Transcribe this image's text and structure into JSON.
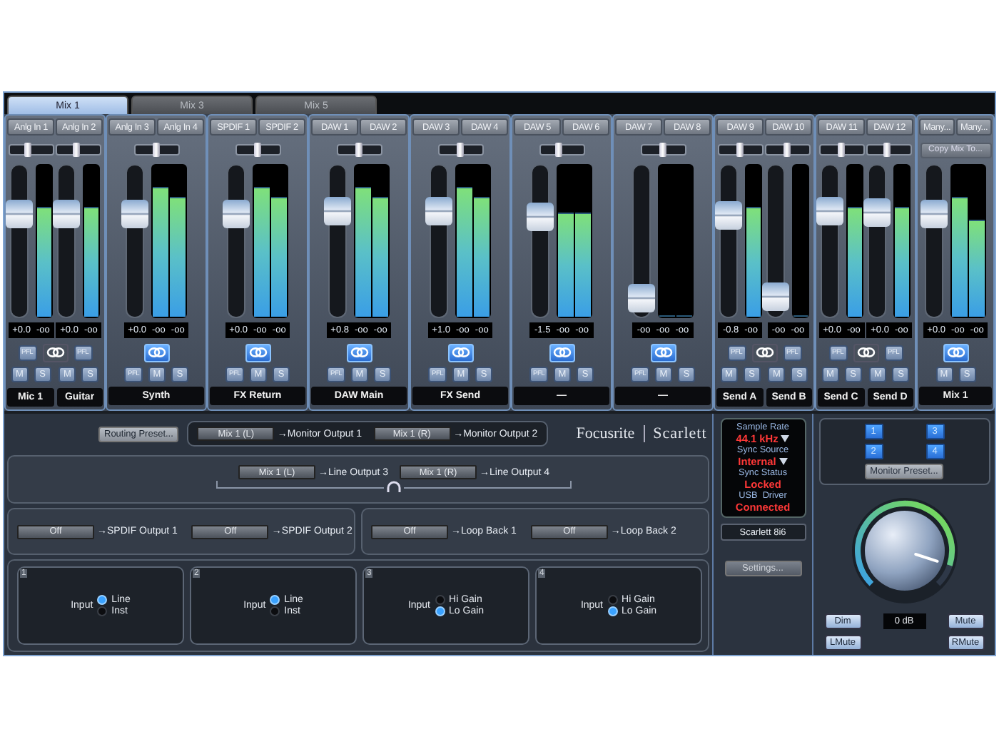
{
  "tabs": [
    {
      "label": "Mix 1",
      "selected": true
    },
    {
      "label": "Mix 3",
      "selected": false
    },
    {
      "label": "Mix 5",
      "selected": false
    }
  ],
  "groups": [
    {
      "kind": "mono",
      "linked": false,
      "channels": [
        {
          "source": "Anlg In 1",
          "pan": {
            "level": 0.42
          },
          "fader": {
            "level": 0.72
          },
          "meters": [
            {
              "level": 0.72
            }
          ],
          "readings": [
            "+0.0",
            "-oo"
          ],
          "pfl": "PFL",
          "buttons": [
            "M",
            "S"
          ],
          "name": "Mic 1"
        },
        {
          "source": "Anlg In 2",
          "pan": {
            "level": 0.45
          },
          "fader": {
            "level": 0.72
          },
          "meters": [
            {
              "level": 0.72
            }
          ],
          "readings": [
            "+0.0",
            "-oo"
          ],
          "pfl": "PFL",
          "buttons": [
            "M",
            "S"
          ],
          "name": "Guitar"
        }
      ]
    },
    {
      "kind": "stereo",
      "sources": [
        "Anlg In 3",
        "Anlg In 4"
      ],
      "pan": {
        "level": 0.5
      },
      "fader": {
        "level": 0.72
      },
      "meters": [
        {
          "level": 0.85
        },
        {
          "level": 0.78
        }
      ],
      "readings": [
        "+0.0",
        "-oo",
        "-oo"
      ],
      "linked": true,
      "pfl": "PFL",
      "buttons": [
        "M",
        "S"
      ],
      "name": "Synth"
    },
    {
      "kind": "stereo",
      "sources": [
        "SPDIF 1",
        "SPDIF 2"
      ],
      "pan": {
        "level": 0.5
      },
      "fader": {
        "level": 0.72
      },
      "meters": [
        {
          "level": 0.85
        },
        {
          "level": 0.78
        }
      ],
      "readings": [
        "+0.0",
        "-oo",
        "-oo"
      ],
      "linked": true,
      "pfl": "PFL",
      "buttons": [
        "M",
        "S"
      ],
      "name": "FX Return"
    },
    {
      "kind": "stereo",
      "sources": [
        "DAW 1",
        "DAW 2"
      ],
      "pan": {
        "level": 0.5
      },
      "fader": {
        "level": 0.75
      },
      "meters": [
        {
          "level": 0.85
        },
        {
          "level": 0.78
        }
      ],
      "readings": [
        "+0.8",
        "-oo",
        "-oo"
      ],
      "linked": true,
      "pfl": "PFL",
      "buttons": [
        "M",
        "S"
      ],
      "name": "DAW Main"
    },
    {
      "kind": "stereo",
      "sources": [
        "DAW 3",
        "DAW 4"
      ],
      "pan": {
        "level": 0.5
      },
      "fader": {
        "level": 0.74
      },
      "meters": [
        {
          "level": 0.85
        },
        {
          "level": 0.78
        }
      ],
      "readings": [
        "+1.0",
        "-oo",
        "-oo"
      ],
      "linked": true,
      "pfl": "PFL",
      "buttons": [
        "M",
        "S"
      ],
      "name": "FX Send"
    },
    {
      "kind": "stereo",
      "sources": [
        "DAW 5",
        "DAW 6"
      ],
      "pan": {
        "level": 0.45
      },
      "fader": {
        "level": 0.7
      },
      "meters": [
        {
          "level": 0.68
        },
        {
          "level": 0.68
        }
      ],
      "readings": [
        "-1.5",
        "-oo",
        "-oo"
      ],
      "linked": true,
      "pfl": "PFL",
      "buttons": [
        "M",
        "S"
      ],
      "name": "—"
    },
    {
      "kind": "stereo",
      "sources": [
        "DAW 7",
        "DAW 8"
      ],
      "pan": {
        "level": 0.5
      },
      "fader": {
        "level": 0.04
      },
      "meters": [
        {
          "level": 0
        },
        {
          "level": 0
        }
      ],
      "readings": [
        "-oo",
        "-oo",
        "-oo"
      ],
      "linked": true,
      "pfl": "PFL",
      "buttons": [
        "M",
        "S"
      ],
      "name": "—"
    },
    {
      "kind": "mono",
      "linked": false,
      "channels": [
        {
          "source": "DAW 9",
          "pan": {
            "level": 0.5
          },
          "fader": {
            "level": 0.71
          },
          "meters": [
            {
              "level": 0.72
            }
          ],
          "readings": [
            "-0.8",
            "-oo"
          ],
          "pfl": "PFL",
          "buttons": [
            "M",
            "S"
          ],
          "name": "Send A"
        },
        {
          "source": "DAW 10",
          "pan": {
            "level": 0.5
          },
          "fader": {
            "level": 0.05
          },
          "meters": [
            {
              "level": 0
            }
          ],
          "readings": [
            "-oo",
            "-oo"
          ],
          "pfl": "PFL",
          "buttons": [
            "M",
            "S"
          ],
          "name": "Send B"
        }
      ]
    },
    {
      "kind": "mono",
      "linked": false,
      "channels": [
        {
          "source": "DAW 11",
          "pan": {
            "level": 0.5
          },
          "fader": {
            "level": 0.74
          },
          "meters": [
            {
              "level": 0.72
            }
          ],
          "readings": [
            "+0.0",
            "-oo"
          ],
          "pfl": "PFL",
          "buttons": [
            "M",
            "S"
          ],
          "name": "Send C"
        },
        {
          "source": "DAW 12",
          "pan": {
            "level": 0.45
          },
          "fader": {
            "level": 0.73
          },
          "meters": [
            {
              "level": 0.72
            }
          ],
          "readings": [
            "+0.0",
            "-oo"
          ],
          "pfl": "PFL",
          "buttons": [
            "M",
            "S"
          ],
          "name": "Send D"
        }
      ]
    },
    {
      "kind": "master",
      "sources": [
        "Many...",
        "Many..."
      ],
      "copy": "Copy Mix To...",
      "fader": {
        "level": 0.72
      },
      "meters": [
        {
          "level": 0.78
        },
        {
          "level": 0.63
        }
      ],
      "readings": [
        "+0.0",
        "-oo",
        "-oo"
      ],
      "linked": true,
      "buttons": [
        "M",
        "S"
      ],
      "name": "Mix 1"
    }
  ],
  "routing_preset": "Routing Preset...",
  "monitor_routes": [
    {
      "source": "Mix 1 (L)",
      "target": "→Monitor Output 1"
    },
    {
      "source": "Mix 1 (R)",
      "target": "→Monitor Output 2"
    }
  ],
  "logo": {
    "brand": "Focusrite",
    "product": "Scarlett"
  },
  "line_routes": [
    {
      "source": "Mix 1 (L)",
      "target": "→Line Output 3"
    },
    {
      "source": "Mix 1 (R)",
      "target": "→Line Output 4"
    }
  ],
  "spdif_routes": [
    {
      "source": "Off",
      "target": "→SPDIF Output 1"
    },
    {
      "source": "Off",
      "target": "→SPDIF Output 2"
    }
  ],
  "loopback_routes": [
    {
      "source": "Off",
      "target": "→Loop Back 1"
    },
    {
      "source": "Off",
      "target": "→Loop Back 2"
    }
  ],
  "inputs": [
    {
      "number": "1",
      "label": "Input",
      "options": [
        {
          "label": "Line",
          "selected": true
        },
        {
          "label": "Inst",
          "selected": false
        }
      ]
    },
    {
      "number": "2",
      "label": "Input",
      "options": [
        {
          "label": "Line",
          "selected": true
        },
        {
          "label": "Inst",
          "selected": false
        }
      ]
    },
    {
      "number": "3",
      "label": "Input",
      "options": [
        {
          "label": "Hi Gain",
          "selected": false
        },
        {
          "label": "Lo Gain",
          "selected": true
        }
      ]
    },
    {
      "number": "4",
      "label": "Input",
      "options": [
        {
          "label": "Hi Gain",
          "selected": false
        },
        {
          "label": "Lo Gain",
          "selected": true
        }
      ]
    }
  ],
  "status": [
    {
      "label": "Sample Rate",
      "value": "44.1 kHz",
      "dropdown": true
    },
    {
      "label": "Sync Source",
      "value": "Internal",
      "dropdown": true
    },
    {
      "label": "Sync Status",
      "value": "Locked",
      "dropdown": false
    },
    {
      "label": "USB  Driver",
      "value": "Connected",
      "dropdown": false
    }
  ],
  "device": "Scarlett 8i6",
  "settings": "Settings...",
  "monitor": {
    "speakers": [
      {
        "label": "1",
        "selected": true
      },
      {
        "label": "3",
        "selected": true
      },
      {
        "label": "2",
        "selected": true
      },
      {
        "label": "4",
        "selected": true
      }
    ],
    "preset": "Monitor Preset...",
    "knob": {
      "level": 0.9
    },
    "dim": "Dim",
    "gain": "0 dB",
    "mute": "Mute",
    "lmute": "LMute",
    "rmute": "RMute"
  }
}
